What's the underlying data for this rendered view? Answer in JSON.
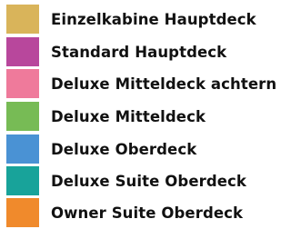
{
  "legend": {
    "items": [
      {
        "label": "Einzelkabine Hauptdeck",
        "color": "#d9b45a"
      },
      {
        "label": "Standard Hauptdeck",
        "color": "#b8479c"
      },
      {
        "label": "Deluxe Mitteldeck achtern",
        "color": "#ef7a9b"
      },
      {
        "label": "Deluxe Mitteldeck",
        "color": "#77bb55"
      },
      {
        "label": "Deluxe Oberdeck",
        "color": "#4a92d4"
      },
      {
        "label": "Deluxe Suite Oberdeck",
        "color": "#18a39a"
      },
      {
        "label": "Owner Suite Oberdeck",
        "color": "#f08a2c"
      }
    ]
  }
}
